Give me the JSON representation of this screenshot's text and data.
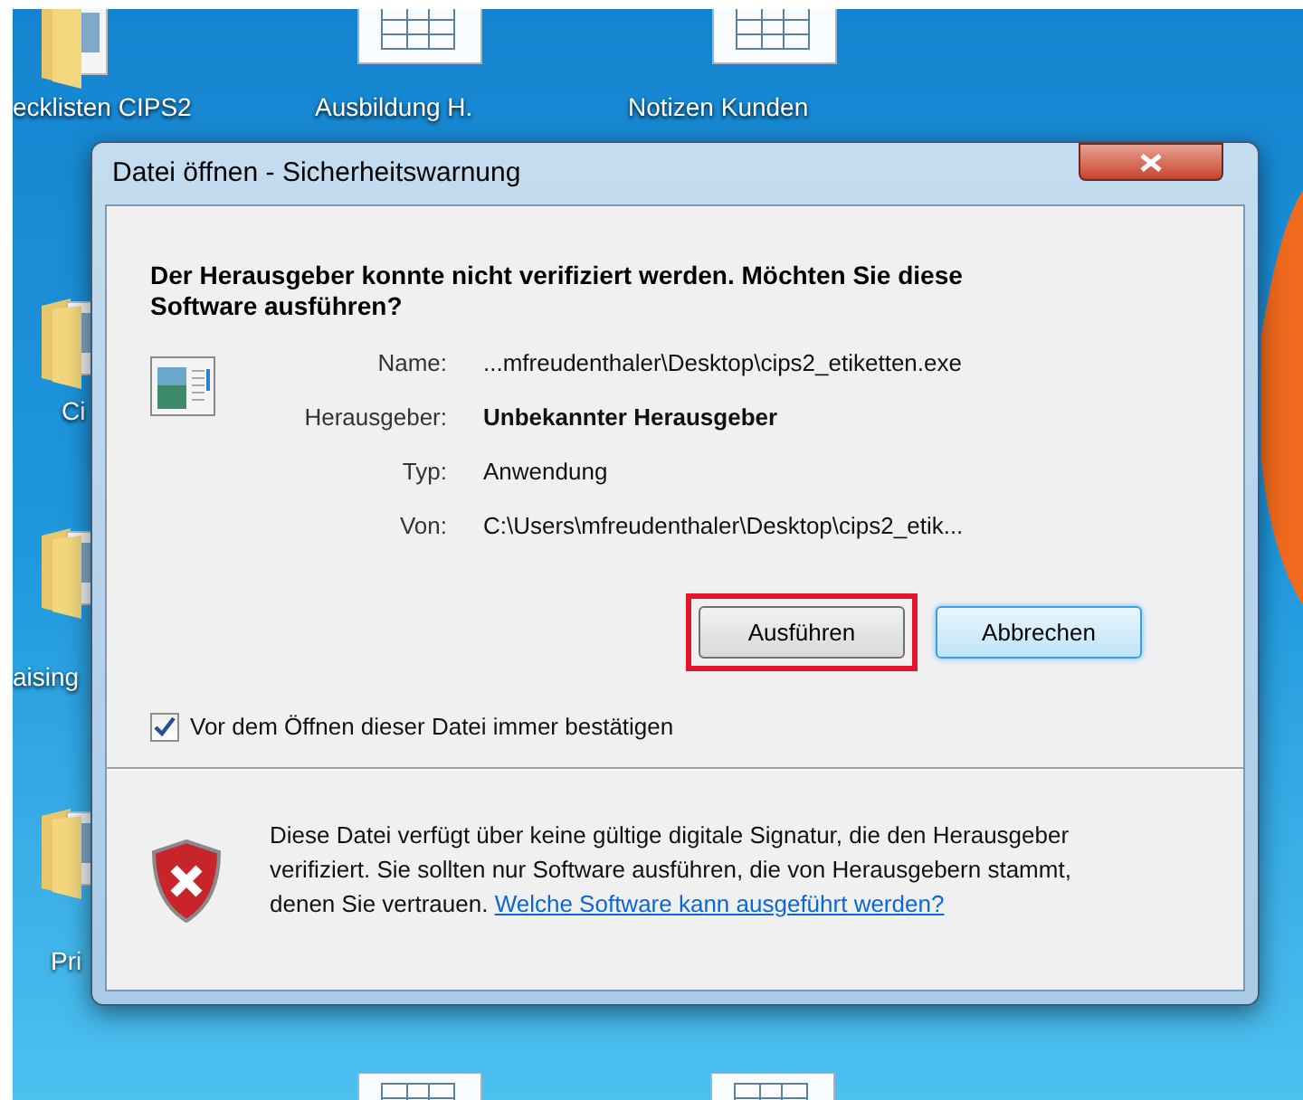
{
  "desktop_icons": [
    {
      "label": "ecklisten CIPS2",
      "kind": "folder"
    },
    {
      "label": "Ausbildung H.",
      "kind": "document"
    },
    {
      "label": "Notizen Kunden",
      "kind": "document"
    },
    {
      "label": "Ci",
      "kind": "folder"
    },
    {
      "label": "aising",
      "kind": "folder"
    },
    {
      "label": "Pri",
      "kind": "folder"
    }
  ],
  "window": {
    "title": "Datei öffnen - Sicherheitswarnung"
  },
  "heading": "Der Herausgeber konnte nicht verifiziert werden. Möchten Sie diese Software ausführen?",
  "details": [
    {
      "label": "Name:",
      "value": "...mfreudenthaler\\Desktop\\cips2_etiketten.exe",
      "bold": false
    },
    {
      "label": "Herausgeber:",
      "value": "Unbekannter Herausgeber",
      "bold": true
    },
    {
      "label": "Typ:",
      "value": "Anwendung",
      "bold": false
    },
    {
      "label": "Von:",
      "value": "C:\\Users\\mfreudenthaler\\Desktop\\cips2_etik...",
      "bold": false
    }
  ],
  "buttons": [
    {
      "label": "Ausführen",
      "highlighted": true,
      "default": false
    },
    {
      "label": "Abbrechen",
      "highlighted": false,
      "default": true
    }
  ],
  "confirm_checkbox": {
    "label": "Vor dem Öffnen dieser Datei immer bestätigen",
    "checked": true
  },
  "warning": {
    "text": "Diese Datei verfügt über keine gültige digitale Signatur, die den Herausgeber verifiziert. Sie sollten nur Software ausführen, die von Herausgebern stammt, denen Sie vertrauen.",
    "link": "Welche Software kann ausgeführt werden?"
  }
}
